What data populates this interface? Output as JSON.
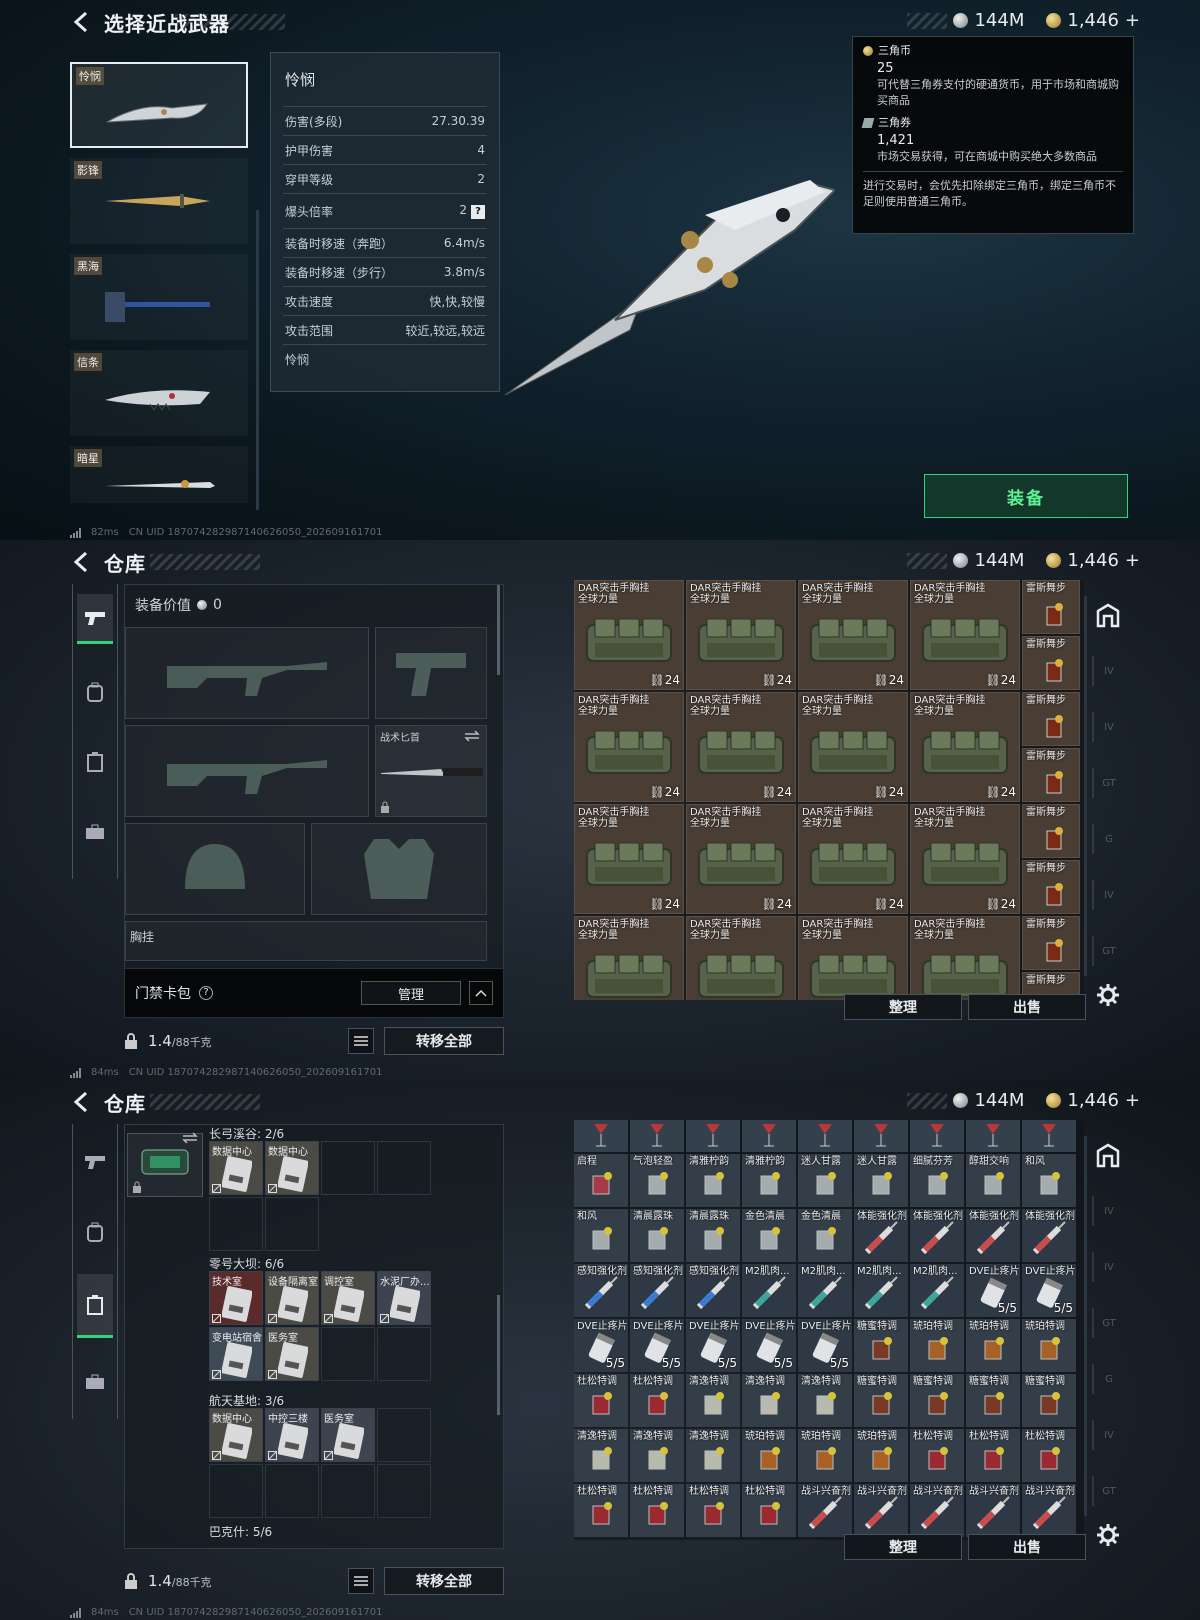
{
  "currency": {
    "coins": "144M",
    "tickets": "1,446"
  },
  "plus_sign": "+",
  "footer": {
    "ping1": "82ms",
    "ping2": "84ms",
    "ping3": "84ms",
    "uid1": "CN UID 187074282987140626050_202609161701",
    "uid2": "CN UID 187074282987140626050_202609161701",
    "uid3": "CN UID 187074282987140626050_202609161701"
  },
  "p1": {
    "title": "选择近战武器",
    "weapons": [
      "怜悯",
      "影锋",
      "黑海",
      "信条",
      "暗星"
    ],
    "stats_title": "怜悯",
    "stats": [
      {
        "k": "伤害(多段)",
        "v": "27.30.39"
      },
      {
        "k": "护甲伤害",
        "v": "4"
      },
      {
        "k": "穿甲等级",
        "v": "2"
      },
      {
        "k": "爆头倍率",
        "v": "2"
      },
      {
        "k": "装备时移速（奔跑）",
        "v": "6.4m/s"
      },
      {
        "k": "装备时移速（步行）",
        "v": "3.8m/s"
      },
      {
        "k": "攻击速度",
        "v": "快,快,较慢"
      },
      {
        "k": "攻击范围",
        "v": "较近,较远,较远"
      }
    ],
    "stats_footer": "怜悯",
    "qmark": "?",
    "tooltip": {
      "h1": "三角币",
      "n1": "25",
      "d1": "可代替三角券支付的硬通货币，用于市场和商城购买商品",
      "h2": "三角券",
      "n2": "1,421",
      "d2": "市场交易获得，可在商城中购买绝大多数商品",
      "note": "进行交易时，会优先扣除绑定三角币，绑定三角币不足则使用普通三角币。"
    },
    "equip": "装备"
  },
  "p2": {
    "title": "仓库",
    "equip_value_label": "装备价值",
    "equip_value": "0",
    "knife_slot": "战术匕首",
    "chest_partial": "胸挂",
    "access_label": "门禁卡包",
    "qmark": "?",
    "manage": "管理",
    "weight": "1.4",
    "weight_max": "/88千克",
    "move_all": "转移全部",
    "sort": "整理",
    "sell": "出售",
    "bag_name1": "DAR突击手胸挂",
    "bag_name2": "全球力量",
    "bag_count": "24",
    "drink_name": "雷斯舞步"
  },
  "p3": {
    "title": "仓库",
    "groups": [
      {
        "title": "长弓溪谷: 2/6",
        "cards": [
          "数据中心",
          "数据中心"
        ]
      },
      {
        "title": "零号大坝: 6/6",
        "cards": [
          "技术室",
          "设备隔离室",
          "调控室",
          "水泥厂办...",
          "变电站宿舍",
          "医务室"
        ]
      },
      {
        "title": "航天基地: 3/6",
        "cards": [
          "数据中心",
          "中控三楼",
          "医务室"
        ]
      },
      {
        "title": "巴克什: 5/6",
        "cards": []
      }
    ],
    "weight": "1.4",
    "weight_max": "/88千克",
    "move_all": "转移全部",
    "sort": "整理",
    "sell": "出售",
    "items": [
      [
        "启程",
        "气泡轻盈",
        "清雅柠韵",
        "清雅柠韵",
        "迷人甘露",
        "迷人甘露",
        "细腻芬芳",
        "醇甜交响",
        "和风"
      ],
      [
        "和风",
        "清晨露珠",
        "清晨露珠",
        "金色清晨",
        "金色清晨",
        "体能强化剂",
        "体能强化剂",
        "体能强化剂",
        "体能强化剂"
      ],
      [
        "感知强化剂",
        "感知强化剂",
        "感知强化剂",
        "M2肌肉...",
        "M2肌肉...",
        "M2肌肉...",
        "M2肌肉...",
        "DVE止疼片",
        "DVE止疼片"
      ],
      [
        "DVE止疼片",
        "DVE止疼片",
        "DVE止疼片",
        "DVE止疼片",
        "DVE止疼片",
        "糖蜜特调",
        "琥珀特调",
        "琥珀特调",
        "琥珀特调"
      ],
      [
        "杜松特调",
        "杜松特调",
        "清逸特调",
        "清逸特调",
        "清逸特调",
        "糖蜜特调",
        "糖蜜特调",
        "糖蜜特调",
        "糖蜜特调"
      ],
      [
        "清逸特调",
        "清逸特调",
        "清逸特调",
        "琥珀特调",
        "琥珀特调",
        "琥珀特调",
        "杜松特调",
        "杜松特调",
        "杜松特调"
      ],
      [
        "杜松特调",
        "杜松特调",
        "杜松特调",
        "杜松特调",
        "战斗兴奋剂",
        "战斗兴奋剂",
        "战斗兴奋剂",
        "战斗兴奋剂",
        "战斗兴奋剂"
      ]
    ],
    "pill_count": "5/5"
  }
}
